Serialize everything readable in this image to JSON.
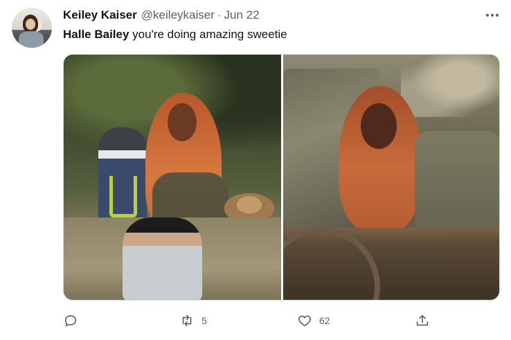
{
  "tweet": {
    "display_name": "Keiley Kaiser",
    "handle": "@keileykaiser",
    "separator": "·",
    "date": "Jun 22",
    "mention": "Halle Bailey",
    "body": " you're doing amazing sweetie"
  },
  "actions": {
    "reply_count": "",
    "retweet_count": "5",
    "like_count": "62",
    "share_count": ""
  },
  "colors": {
    "text_primary": "#0f1419",
    "text_secondary": "#536471",
    "border": "#cfd9de"
  },
  "icons": [
    "more-icon",
    "reply-icon",
    "retweet-icon",
    "like-icon",
    "share-icon"
  ]
}
